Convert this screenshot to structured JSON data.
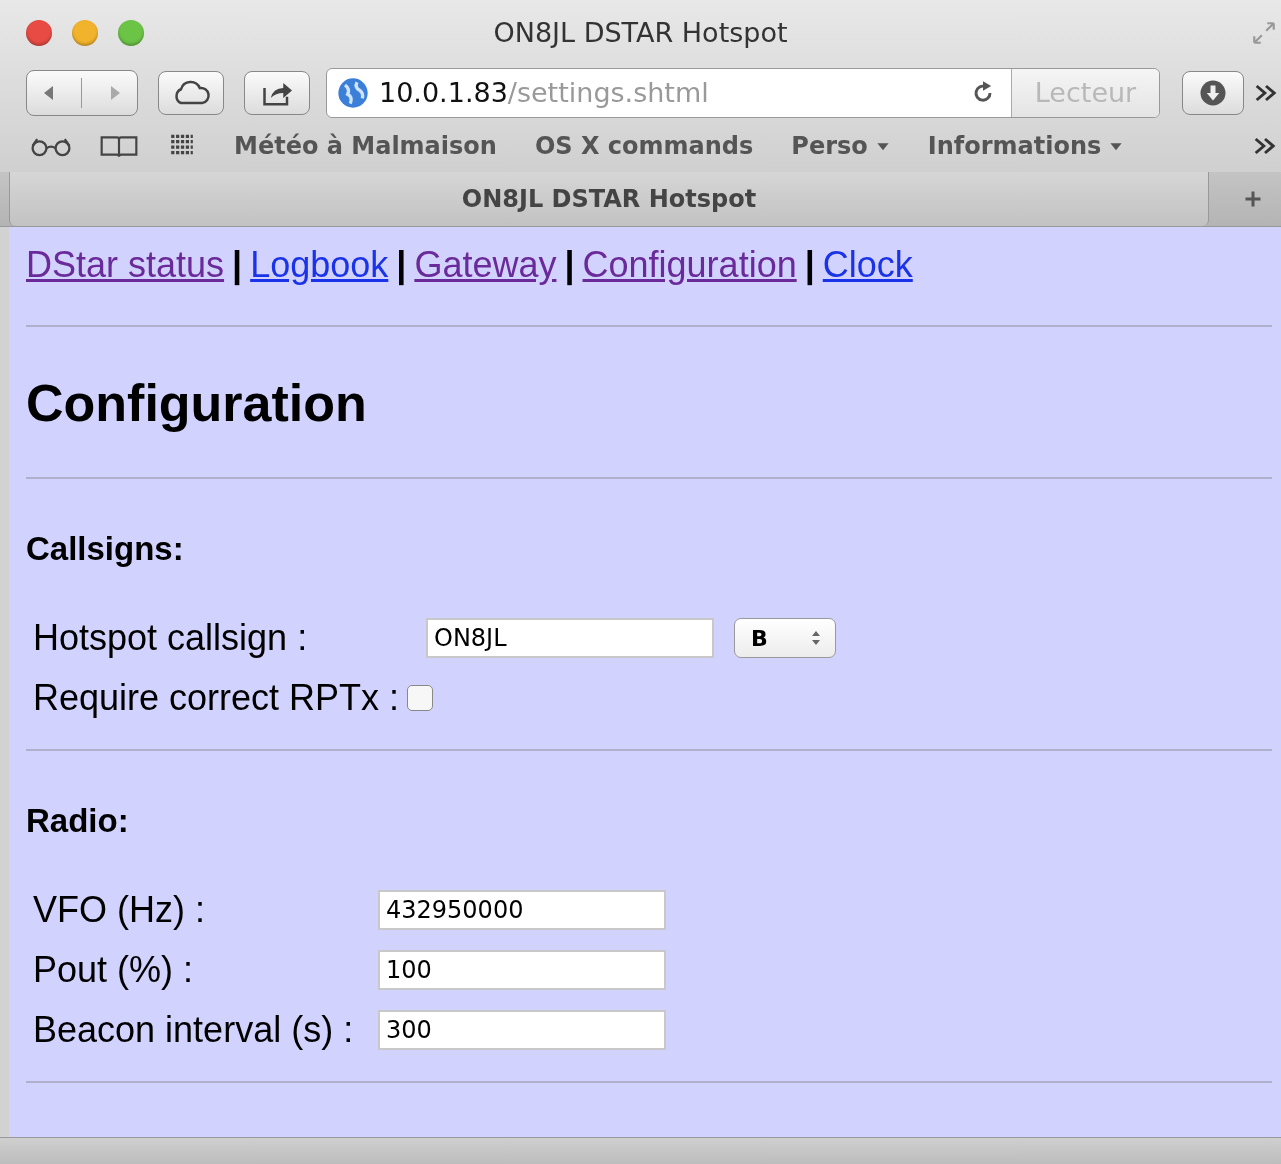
{
  "window": {
    "title": "ON8JL DSTAR Hotspot"
  },
  "toolbar": {
    "address_host": "10.0.1.83",
    "address_path": "/settings.shtml",
    "reader_button": "Lecteur"
  },
  "bookmarks": [
    {
      "kind": "link",
      "label": "Météo à Malmaison"
    },
    {
      "kind": "link",
      "label": "OS X commands"
    },
    {
      "kind": "menu",
      "label": "Perso"
    },
    {
      "kind": "menu",
      "label": "Informations"
    }
  ],
  "tab": {
    "title": "ON8JL DSTAR Hotspot"
  },
  "nav": [
    {
      "kind": "link",
      "label": "DStar status",
      "visited": true
    },
    {
      "kind": "separator",
      "label": "|"
    },
    {
      "kind": "link",
      "label": "Logbook",
      "visited": false
    },
    {
      "kind": "separator",
      "label": "|"
    },
    {
      "kind": "link",
      "label": "Gateway",
      "visited": true
    },
    {
      "kind": "separator",
      "label": "|"
    },
    {
      "kind": "link",
      "label": "Configuration",
      "visited": true
    },
    {
      "kind": "separator",
      "label": "|"
    },
    {
      "kind": "link",
      "label": "Clock",
      "visited": false
    }
  ],
  "heading": "Configuration",
  "sections": [
    {
      "title": "Callsigns:",
      "fields": [
        {
          "kind": "text_select",
          "label": "Hotspot callsign :",
          "value": "ON8JL",
          "select": "B"
        },
        {
          "kind": "checkbox",
          "label": "Require correct RPTx :",
          "checked": false
        }
      ]
    },
    {
      "title": "Radio:",
      "fields": [
        {
          "kind": "text",
          "label": "VFO (Hz) :",
          "value": "432950000"
        },
        {
          "kind": "text",
          "label": "Pout (%) :",
          "value": "100"
        },
        {
          "kind": "text",
          "label": "Beacon interval (s) :",
          "value": "300"
        }
      ]
    }
  ]
}
